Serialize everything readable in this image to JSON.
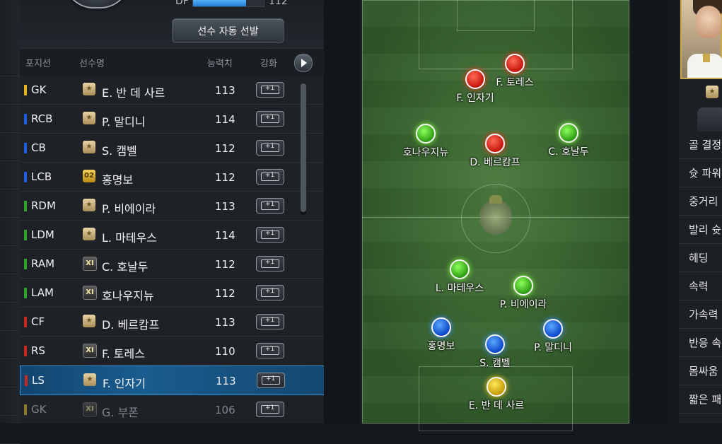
{
  "stat": {
    "label": "DF",
    "value": "112",
    "fill_percent": 75
  },
  "auto_select_label": "선수 자동 선발",
  "columns": {
    "position": "포지션",
    "name": "선수명",
    "overall": "능력치",
    "upgrade": "강화"
  },
  "upgrade_label": "+1",
  "players": [
    {
      "pos": "GK",
      "color": "#e3b51a",
      "badge": "star",
      "badge_text": "★",
      "name": "E. 반 데 사르",
      "ovr": "113"
    },
    {
      "pos": "RCB",
      "color": "#1f5ee0",
      "badge": "star",
      "badge_text": "★",
      "name": "P. 말디니",
      "ovr": "114"
    },
    {
      "pos": "CB",
      "color": "#1f5ee0",
      "badge": "star",
      "badge_text": "★",
      "name": "S. 캠벨",
      "ovr": "112"
    },
    {
      "pos": "LCB",
      "color": "#1f5ee0",
      "badge": "b02",
      "badge_text": "02",
      "name": "홍명보",
      "ovr": "112"
    },
    {
      "pos": "RDM",
      "color": "#2ea52a",
      "badge": "star",
      "badge_text": "★",
      "name": "P. 비에이라",
      "ovr": "113"
    },
    {
      "pos": "LDM",
      "color": "#2ea52a",
      "badge": "star",
      "badge_text": "★",
      "name": "L. 마테우스",
      "ovr": "114"
    },
    {
      "pos": "RAM",
      "color": "#2ea52a",
      "badge": "xi",
      "badge_text": "XI",
      "name": "C. 호날두",
      "ovr": "112"
    },
    {
      "pos": "LAM",
      "color": "#2ea52a",
      "badge": "xi",
      "badge_text": "XI",
      "name": "호나우지뉴",
      "ovr": "112"
    },
    {
      "pos": "CF",
      "color": "#c8281e",
      "badge": "star",
      "badge_text": "★",
      "name": "D. 베르캄프",
      "ovr": "113"
    },
    {
      "pos": "RS",
      "color": "#c8281e",
      "badge": "xi",
      "badge_text": "XI",
      "name": "F. 토레스",
      "ovr": "110"
    },
    {
      "pos": "LS",
      "color": "#c8281e",
      "badge": "star",
      "badge_text": "★",
      "name": "F. 인자기",
      "ovr": "113",
      "selected": true
    },
    {
      "pos": "GK",
      "color": "#8a7a2a",
      "badge": "xi",
      "badge_text": "XI",
      "name": "G. 부폰",
      "ovr": "106",
      "bench": true
    }
  ],
  "pitch_players": [
    {
      "name": "F. 토레스",
      "color": "red"
    },
    {
      "name": "F. 인자기",
      "color": "red"
    },
    {
      "name": "호나우지뉴",
      "color": "green"
    },
    {
      "name": "D. 베르캄프",
      "color": "red"
    },
    {
      "name": "C. 호날두",
      "color": "green"
    },
    {
      "name": "L. 마테우스",
      "color": "green"
    },
    {
      "name": "P. 비에이라",
      "color": "green"
    },
    {
      "name": "홍명보",
      "color": "blue"
    },
    {
      "name": "P. 말디니",
      "color": "blue"
    },
    {
      "name": "S. 캠벨",
      "color": "blue"
    },
    {
      "name": "E. 반 데 사르",
      "color": "yellow"
    }
  ],
  "attributes": [
    "골 결정",
    "슛 파워",
    "중거리",
    "발리 슛",
    "헤딩",
    "속력",
    "가속력",
    "반응 속",
    "몸싸움",
    "짧은 패"
  ]
}
